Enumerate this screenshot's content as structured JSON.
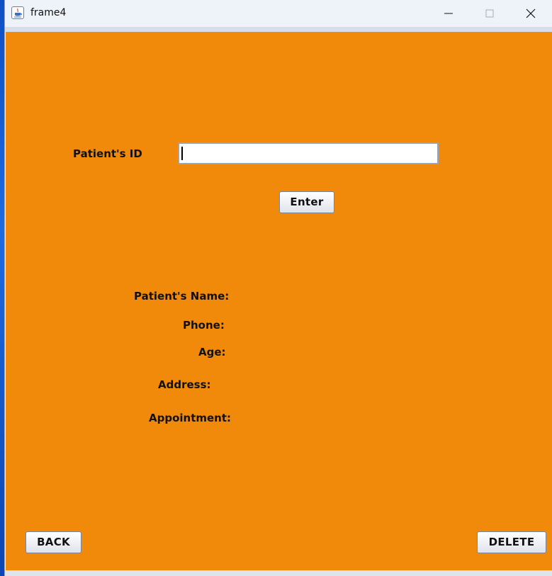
{
  "window": {
    "title": "frame4",
    "icon": "java-cup-icon",
    "controls": [
      "minimize-icon",
      "maximize-icon",
      "close-icon"
    ]
  },
  "colors": {
    "content_background": "#f18a0a",
    "titlebar_background": "#eef2f9"
  },
  "form": {
    "id_label": "Patient's ID",
    "id_value": "",
    "enter_label": "Enter"
  },
  "details": {
    "name_label": "Patient's Name:",
    "phone_label": "Phone:",
    "age_label": "Age:",
    "address_label": "Address:",
    "appointment_label": "Appointment:"
  },
  "actions": {
    "back_label": "BACK",
    "delete_label": "DELETE"
  }
}
